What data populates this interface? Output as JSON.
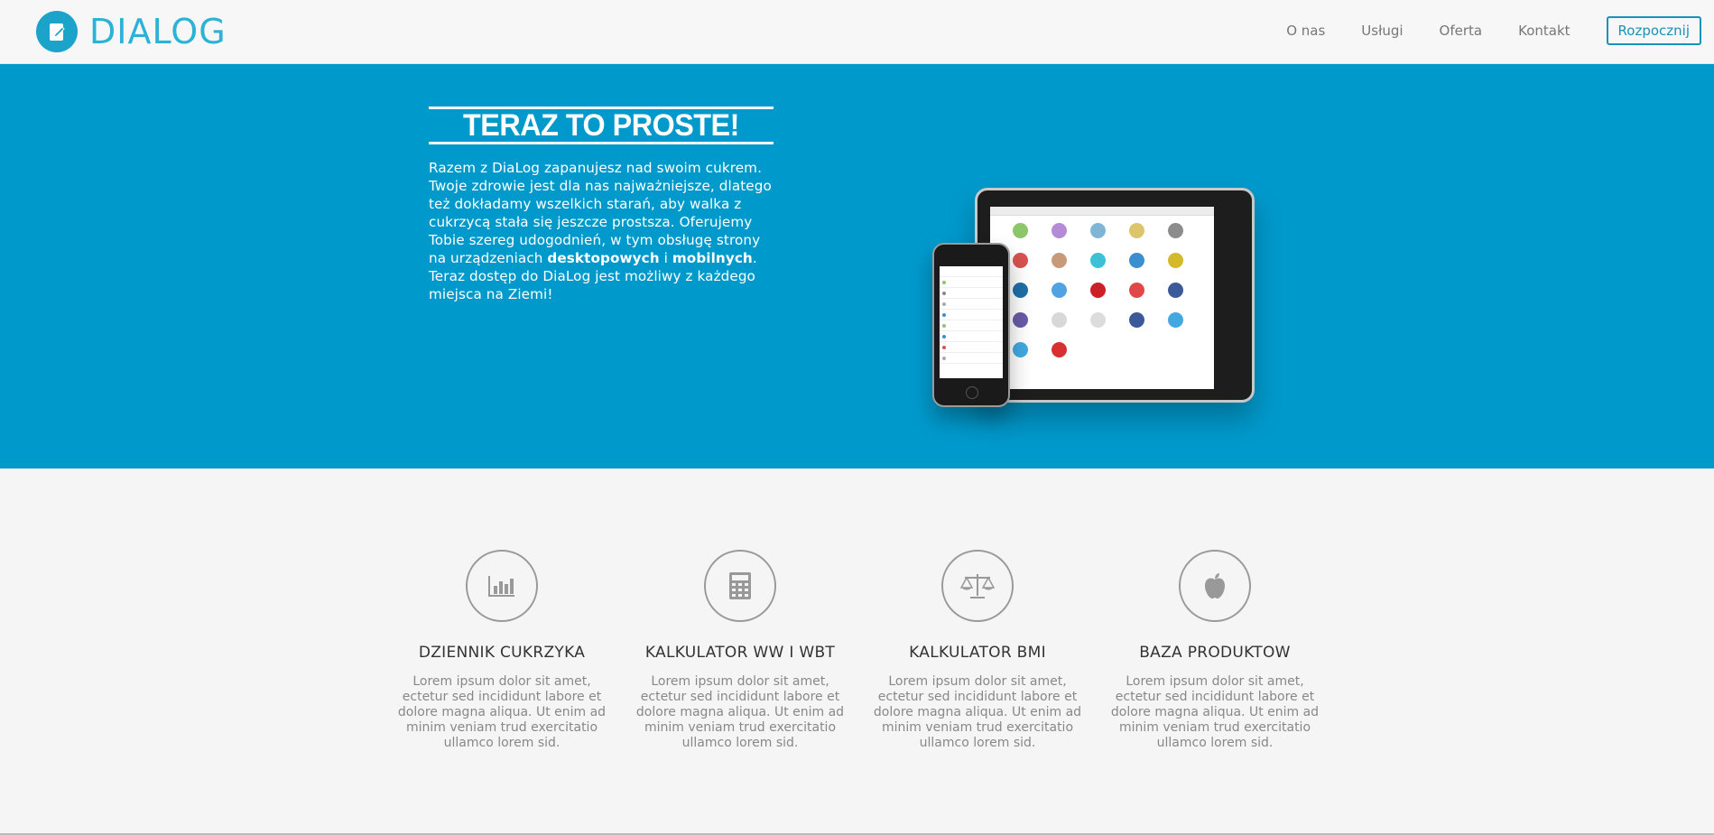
{
  "brand": {
    "name": "DIALOG",
    "accent": "#1ba3c9"
  },
  "nav": {
    "items": [
      "O nas",
      "Usługi",
      "Oferta",
      "Kontakt"
    ],
    "cta_label": "Rozpocznij"
  },
  "hero": {
    "title": "TERAZ TO PROSTE!",
    "text_before": "Razem z DiaLog zapanujesz nad swoim cukrem. Twoje zdrowie jest dla nas najważniejsze, dlatego też dokładamy wszelkich starań, aby walka z cukrzycą stała się jeszcze prostsza. Oferujemy Tobie szereg udogodnień, w tym obsługę strony na urządzeniach ",
    "bold1": "desktopowych",
    "connector": " i ",
    "bold2": "mobilnych",
    "text_after": ". Teraz dostęp do DiaLog jest możliwy z każdego miejsca na Ziemi!",
    "background": "#0099cc"
  },
  "features": [
    {
      "icon": "bar-chart-icon",
      "title": "DZIENNIK CUKRZYKA",
      "text": "Lorem ipsum dolor sit amet, ectetur sed incididunt labore et dolore magna aliqua. Ut enim ad minim veniam trud exercitatio ullamco lorem sid."
    },
    {
      "icon": "calculator-icon",
      "title": "KALKULATOR WW I WBT",
      "text": "Lorem ipsum dolor sit amet, ectetur sed incididunt labore et dolore magna aliqua. Ut enim ad minim veniam trud exercitatio ullamco lorem sid."
    },
    {
      "icon": "scale-icon",
      "title": "KALKULATOR BMI",
      "text": "Lorem ipsum dolor sit amet, ectetur sed incididunt labore et dolore magna aliqua. Ut enim ad minim veniam trud exercitatio ullamco lorem sid."
    },
    {
      "icon": "apple-icon",
      "title": "BAZA PRODUKTOW",
      "text": "Lorem ipsum dolor sit amet, ectetur sed incididunt labore et dolore magna aliqua. Ut enim ad minim veniam trud exercitatio ullamco lorem sid."
    }
  ]
}
